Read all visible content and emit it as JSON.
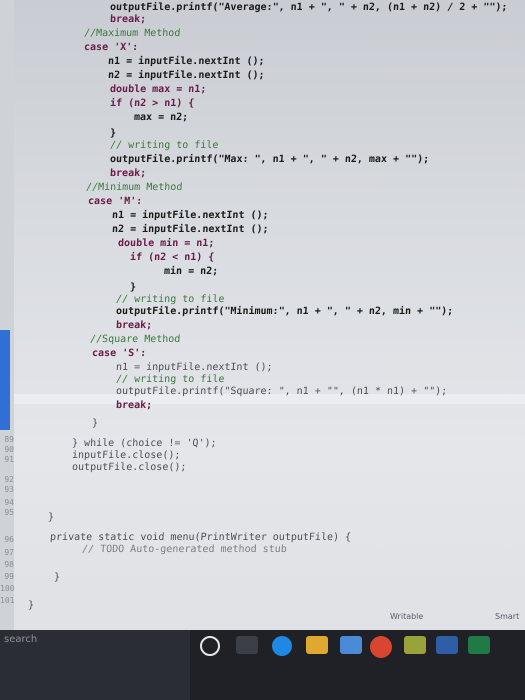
{
  "editor": {
    "lines": [
      "outputFile.printf(\"Average:\", n1 + \", \" + n2, (n1 + n2) / 2 + \"\");",
      "break;",
      "//Maximum Method",
      "case 'X':",
      "n1 = inputFile.nextInt ();",
      "n2 = inputFile.nextInt ();",
      "double max = n1;",
      "if (n2 > n1) {",
      "max = n2;",
      "}",
      "// writing to file",
      "outputFile.printf(\"Max: \", n1 + \", \" + n2, max + \"\");",
      "break;",
      "//Minimum Method",
      "case 'M':",
      "n1 = inputFile.nextInt ();",
      "n2 = inputFile.nextInt ();",
      "double min = n1;",
      "if (n2 < n1) {",
      "min = n2;",
      "}",
      "// writing to file",
      "outputFile.printf(\"Minimum:\", n1 + \", \" + n2, min + \"\");",
      "break;",
      "//Square Method",
      "case 'S':",
      "n1 = inputFile.nextInt ();",
      "// writing to file",
      "outputFile.printf(\"Square: \", n1 + \"\", (n1 * n1) + \"\");",
      "break;",
      "}",
      "} while (choice != 'Q');",
      "inputFile.close();",
      "outputFile.close();",
      "}",
      "private static void menu(PrintWriter outputFile) {",
      "// TODO Auto-generated method stub",
      "}",
      "}"
    ],
    "line_numbers": [
      "89",
      "90",
      "91",
      "92",
      "93",
      "94",
      "95",
      "96",
      "97",
      "98",
      "99",
      "100",
      "101"
    ]
  },
  "statusbar": {
    "writable": "Writable",
    "smart": "Smart"
  },
  "taskbar": {
    "search_placeholder": "search"
  }
}
